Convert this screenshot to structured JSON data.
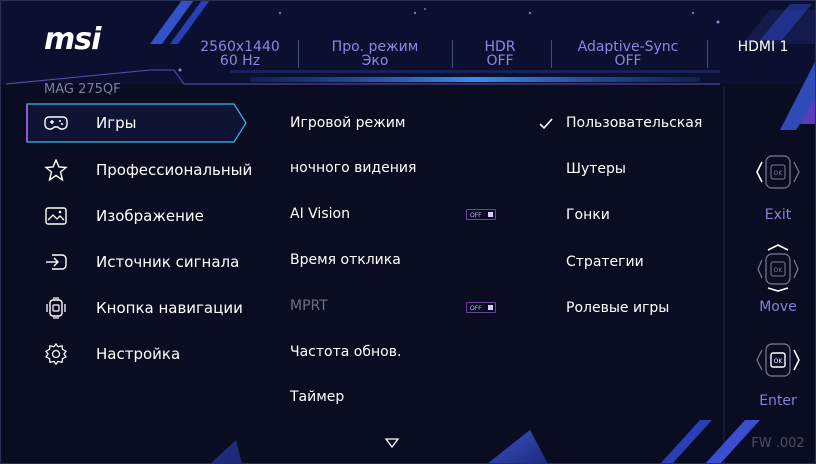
{
  "header": {
    "brand": "msi",
    "model": "MAG 275QF",
    "status": [
      {
        "line1": "2560x1440",
        "line2": "60 Hz"
      },
      {
        "line1": "Про. режим",
        "line2": "Эко"
      },
      {
        "line1": "HDR",
        "line2": "OFF"
      },
      {
        "line1": "Adaptive-Sync",
        "line2": "OFF"
      },
      {
        "line1": "HDMI 1",
        "line2": ""
      }
    ]
  },
  "menu": {
    "items": [
      {
        "label": "Игры",
        "icon": "gamepad-icon",
        "selected": true
      },
      {
        "label": "Профессиональный",
        "icon": "star-icon"
      },
      {
        "label": "Изображение",
        "icon": "image-icon"
      },
      {
        "label": "Источник сигнала",
        "icon": "input-source-icon"
      },
      {
        "label": "Кнопка навигации",
        "icon": "navigation-key-icon"
      },
      {
        "label": "Настройка",
        "icon": "settings-gear-icon"
      }
    ]
  },
  "submenu": {
    "items": [
      {
        "label": "Игровой режим",
        "disabled": false
      },
      {
        "label": "ночного видения",
        "disabled": false
      },
      {
        "label": "AI Vision",
        "disabled": false,
        "toggle": "OFF"
      },
      {
        "label": "Время отклика",
        "disabled": false
      },
      {
        "label": "MPRT",
        "disabled": true,
        "toggle": "OFF"
      },
      {
        "label": "Частота обнов.",
        "disabled": false
      },
      {
        "label": "Таймер",
        "disabled": false
      }
    ],
    "more_icon": "triangle-down-icon"
  },
  "options": {
    "items": [
      {
        "label": "Пользовательская",
        "checked": true
      },
      {
        "label": "Шутеры"
      },
      {
        "label": "Гонки"
      },
      {
        "label": "Стратегии"
      },
      {
        "label": "Ролевые игры"
      }
    ]
  },
  "nav": {
    "exit_label": "Exit",
    "move_label": "Move",
    "enter_label": "Enter",
    "ok_text": "OK"
  },
  "firmware": "FW .002",
  "colors": {
    "background": "#0a0d22",
    "accent_purple": "#8f86e0",
    "accent_blue": "#2a6fd6",
    "highlight_cyan": "#3fb9f0",
    "text": "#ffffff",
    "disabled_text": "#6e6f82"
  }
}
